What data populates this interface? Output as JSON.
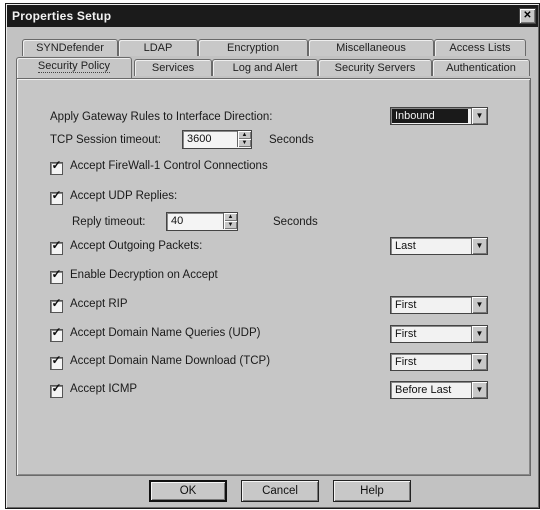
{
  "window": {
    "title": "Properties Setup",
    "close_glyph": "✕"
  },
  "tabs_back": [
    "SYNDefender",
    "LDAP",
    "Encryption",
    "Miscellaneous",
    "Access Lists"
  ],
  "tabs_front": [
    "Security Policy",
    "Services",
    "Log and Alert",
    "Security Servers",
    "Authentication"
  ],
  "active_tab": "Security Policy",
  "gateway": {
    "label": "Apply Gateway Rules to Interface Direction:",
    "value": "Inbound"
  },
  "tcp_timeout": {
    "label": "TCP Session timeout:",
    "value": "3600",
    "unit": "Seconds"
  },
  "checks": {
    "firewall_control": {
      "label": "Accept FireWall-1 Control Connections",
      "checked": true
    },
    "udp_replies": {
      "label": "Accept UDP Replies:",
      "checked": true
    },
    "outgoing": {
      "label": "Accept Outgoing Packets:",
      "checked": true,
      "value": "Last"
    },
    "decryption": {
      "label": "Enable Decryption on Accept",
      "checked": true
    },
    "rip": {
      "label": "Accept RIP",
      "checked": true,
      "value": "First"
    },
    "dns_udp": {
      "label": "Accept Domain Name Queries (UDP)",
      "checked": true,
      "value": "First"
    },
    "dns_tcp": {
      "label": "Accept Domain Name Download (TCP)",
      "checked": true,
      "value": "First"
    },
    "icmp": {
      "label": "Accept ICMP",
      "checked": true,
      "value": "Before Last"
    }
  },
  "reply_timeout": {
    "label": "Reply timeout:",
    "value": "40",
    "unit": "Seconds"
  },
  "buttons": {
    "ok": "OK",
    "cancel": "Cancel",
    "help": "Help"
  },
  "icons": {
    "checkmark": "✓",
    "dropdown": "chevron-down-icon",
    "spin_up": "▲",
    "spin_down": "▼",
    "arrow": "▼"
  }
}
